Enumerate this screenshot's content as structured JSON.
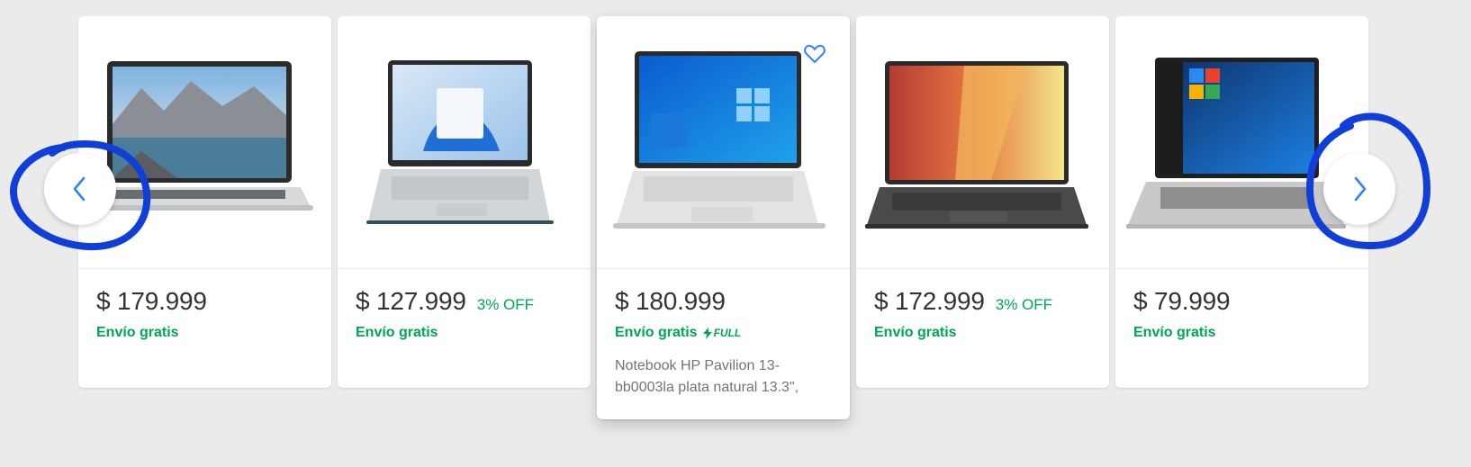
{
  "colors": {
    "background": "#ebebeb",
    "card": "#ffffff",
    "price_text": "#333333",
    "accent_green": "#00a650",
    "title_text": "#737373",
    "nav_arrow": "#3483fa",
    "annotation_ink": "#0f3ed8"
  },
  "carousel": {
    "prev_icon": "chevron-left-icon",
    "next_icon": "chevron-right-icon",
    "cards": [
      {
        "image_icon": "laptop-dell-landscape-wallpaper",
        "price": "$ 179.999",
        "discount": "",
        "shipping": "Envío gratis",
        "full_label": "",
        "title": ""
      },
      {
        "image_icon": "laptop-hp-windows11-wallpaper",
        "price": "$ 127.999",
        "discount": "3% OFF",
        "shipping": "Envío gratis",
        "full_label": "",
        "title": ""
      },
      {
        "image_icon": "laptop-hp-windows10-wallpaper",
        "price": "$ 180.999",
        "discount": "",
        "shipping": "Envío gratis",
        "full_label": "FULL",
        "title": "Notebook HP Pavilion 13-bb0003la plata natural 13.3\",",
        "favorite_icon": "heart-outline-icon"
      },
      {
        "image_icon": "laptop-asus-vivobook-wallpaper",
        "price": "$ 172.999",
        "discount": "3% OFF",
        "shipping": "Envío gratis",
        "full_label": "",
        "title": ""
      },
      {
        "image_icon": "laptop-windows10-start-menu-wallpaper",
        "price": "$ 79.999",
        "discount": "",
        "shipping": "Envío gratis",
        "full_label": "",
        "title": ""
      }
    ]
  }
}
